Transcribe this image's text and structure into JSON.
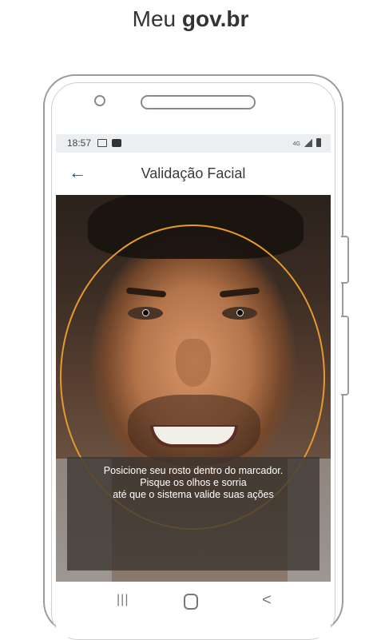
{
  "heading": {
    "prefix": "Meu ",
    "brand": "gov.br"
  },
  "status_bar": {
    "time": "18:57"
  },
  "app_bar": {
    "back_icon": "←",
    "title": "Validação Facial"
  },
  "camera": {
    "instructions": [
      "Posicione seu rosto dentro do marcador.",
      "Pisque os olhos e sorria",
      "até que o sistema valide suas ações"
    ],
    "marker_color": "#e69a2e"
  },
  "nav_bar": {
    "recent_glyph": "|||",
    "back_glyph": "<"
  },
  "colors": {
    "accent": "#1351b4"
  }
}
